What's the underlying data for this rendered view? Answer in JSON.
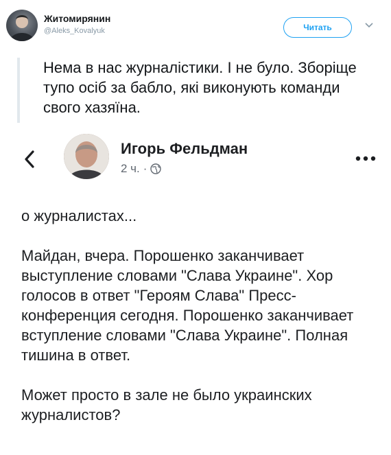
{
  "tweet": {
    "author_name": "Житомирянин",
    "author_handle": "@Aleks_Kovalyuk",
    "follow_label": "Читать",
    "text": "Нема в нас журналістики. І не було. Зборіще тупо осіб за бабло, які виконують команди свого хазяїна."
  },
  "fb_post": {
    "author_name": "Игорь Фельдман",
    "time": "2 ч.",
    "separator": "·",
    "paragraph_1": "о журналистах...",
    "paragraph_2": "Майдан, вчера. Порошенко заканчивает выступление словами \"Слава Украине\". Хор голосов в ответ \"Героям Слава\" Пресс-конференция сегодня. Порошенко заканчивает вступление словами \"Слава Украине\". Полная тишина в ответ.",
    "paragraph_3": "Может просто в зале не было украинских журналистов?"
  },
  "colors": {
    "twitter_blue": "#1da1f2",
    "muted": "#8899a6",
    "fb_text": "#1c1e21",
    "fb_meta": "#606770"
  },
  "icons": [
    "chevron-down-icon",
    "back-arrow-icon",
    "globe-icon",
    "more-options-icon"
  ]
}
